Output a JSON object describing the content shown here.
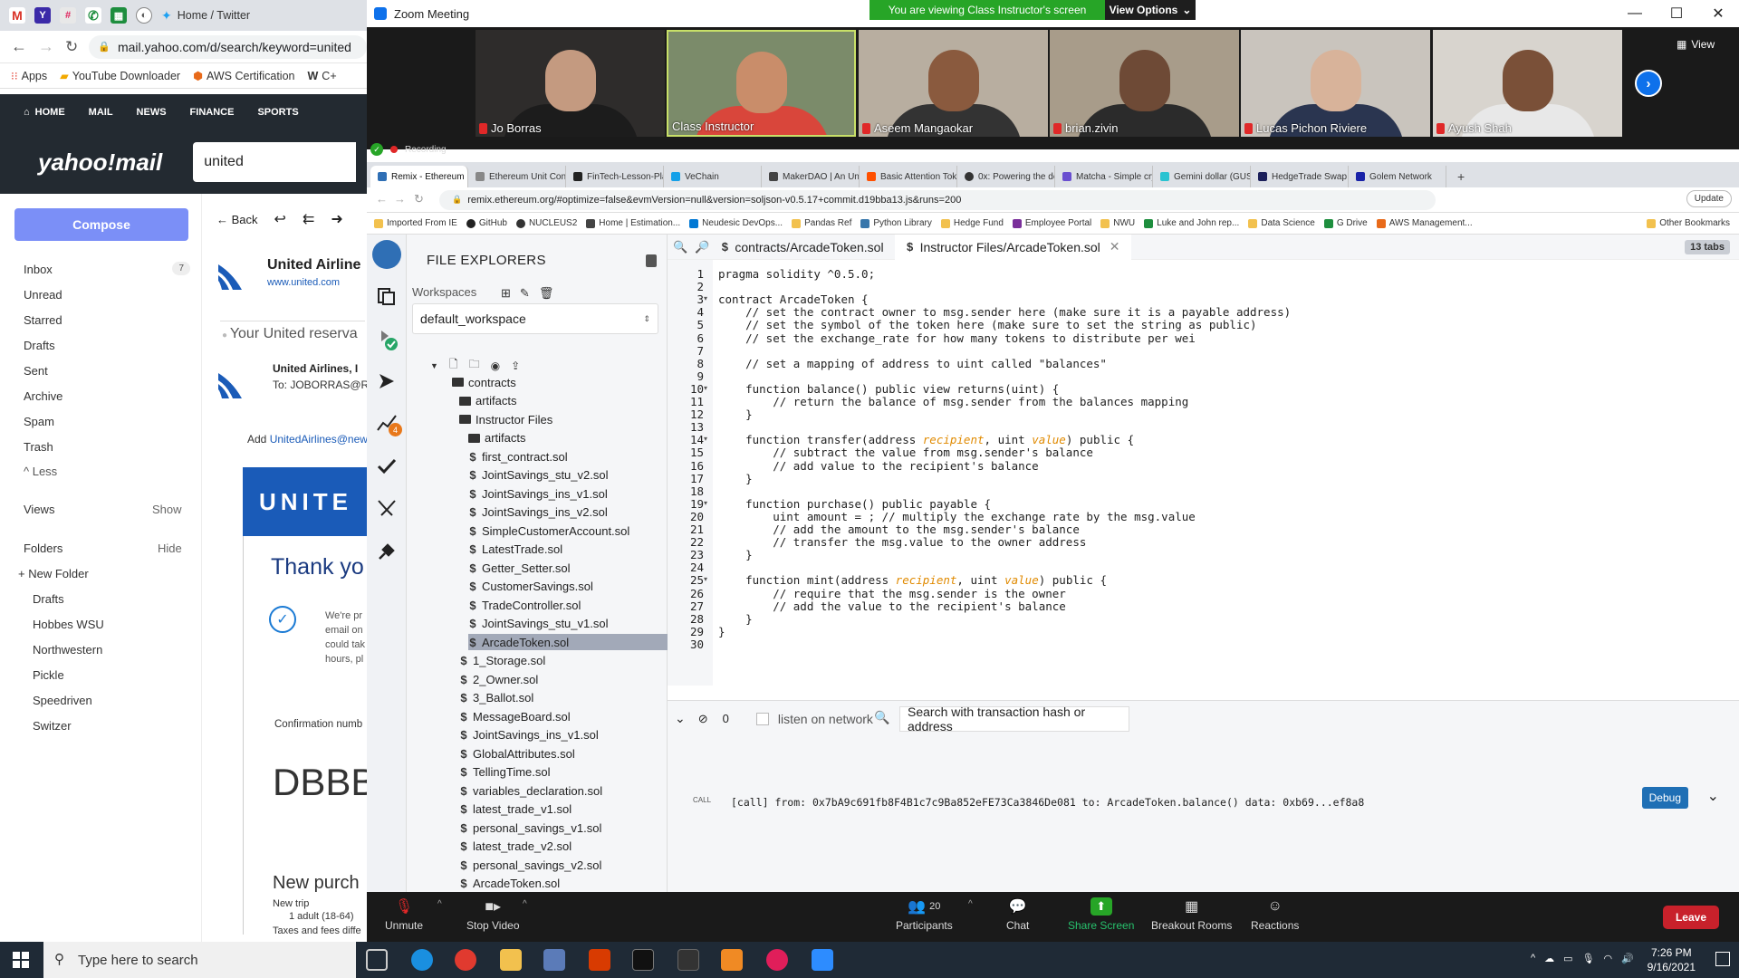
{
  "bg_browser": {
    "tab_title": "Home / Twitter",
    "url": "mail.yahoo.com/d/search/keyword=united",
    "bookmarks": [
      "Apps",
      "YouTube Downloader",
      "AWS Certification",
      "C+"
    ]
  },
  "yahoo": {
    "nav": [
      "HOME",
      "MAIL",
      "NEWS",
      "FINANCE",
      "SPORTS"
    ],
    "logo": "yahoo!mail",
    "search_value": "united",
    "compose": "Compose",
    "folders": [
      "Inbox",
      "Unread",
      "Starred",
      "Drafts",
      "Sent",
      "Archive",
      "Spam",
      "Trash"
    ],
    "inbox_count": "7",
    "less": "Less",
    "views": "Views",
    "show": "Show",
    "folders_label": "Folders",
    "hide": "Hide",
    "new_folder": "New Folder",
    "custom_folders": [
      "Drafts",
      "Hobbes WSU",
      "Northwestern",
      "Pickle",
      "Speedriven",
      "Switzer"
    ],
    "back": "Back",
    "sender_name": "United Airline",
    "sender_url": "www.united.com",
    "subject": "Your United reserva",
    "from": "United Airlines, I",
    "to": "To: JOBORRAS@R",
    "add_text": "Add ",
    "add_link": "UnitedAirlines@new",
    "banner": "UNITE",
    "thank": "Thank yo",
    "body_lines": [
      "We're pr",
      "email on",
      "could tak",
      "hours, pl"
    ],
    "confirmation": "Confirmation numb",
    "conf_code": "DBBB",
    "new_purchase": "New purch",
    "new_trip": "New trip",
    "adult": "1 adult (18-64)",
    "taxes": "Taxes and fees diffe"
  },
  "zoom": {
    "title": "Zoom Meeting",
    "viewing": "You are viewing Class Instructor's screen",
    "view_options": "View Options",
    "view": "View",
    "participants": [
      "Jo Borras",
      "Class Instructor",
      "Aseem Mangaokar",
      "brian.zivin",
      "Lucas Pichon Riviere",
      "Ayush Shah"
    ],
    "recording": "Recording",
    "toolbar": {
      "unmute": "Unmute",
      "stop_video": "Stop Video",
      "participants": "Participants",
      "participants_count": "20",
      "chat": "Chat",
      "share": "Share Screen",
      "breakout": "Breakout Rooms",
      "reactions": "Reactions",
      "leave": "Leave"
    }
  },
  "inner_browser": {
    "tabs": [
      "Remix - Ethereum",
      "Ethereum Unit Conver",
      "FinTech-Lesson-Plans",
      "VeChain",
      "MakerDAO | An Unbias",
      "Basic Attention Token",
      "0x: Powering the dece",
      "Matcha - Simple crypt",
      "Gemini dollar (GUSD)",
      "HedgeTrade Swap",
      "Golem Network"
    ],
    "url": "remix.ethereum.org/#optimize=false&evmVersion=null&version=soljson-v0.5.17+commit.d19bba13.js&runs=200",
    "update": "Update",
    "bookmarks": [
      "Imported From IE",
      "GitHub",
      "NUCLEUS2",
      "Home | Estimation...",
      "Neudesic DevOps...",
      "Pandas Ref",
      "Python Library",
      "Hedge Fund",
      "Employee Portal",
      "NWU",
      "Luke and John rep...",
      "Data Science",
      "G Drive",
      "AWS Management..."
    ],
    "other_bookmarks": "Other Bookmarks"
  },
  "remix": {
    "file_explorers": "FILE EXPLORERS",
    "workspaces": "Workspaces",
    "workspace": "default_workspace",
    "plugin_badge": "4",
    "tree": [
      {
        "name": "contracts",
        "type": "folder",
        "indent": 0
      },
      {
        "name": "artifacts",
        "type": "folder",
        "indent": 1
      },
      {
        "name": "Instructor Files",
        "type": "folder",
        "indent": 1
      },
      {
        "name": "artifacts",
        "type": "folder",
        "indent": 2
      },
      {
        "name": "first_contract.sol",
        "type": "file",
        "indent": 2
      },
      {
        "name": "JointSavings_stu_v2.sol",
        "type": "file",
        "indent": 2
      },
      {
        "name": "JointSavings_ins_v1.sol",
        "type": "file",
        "indent": 2
      },
      {
        "name": "JointSavings_ins_v2.sol",
        "type": "file",
        "indent": 2
      },
      {
        "name": "SimpleCustomerAccount.sol",
        "type": "file",
        "indent": 2
      },
      {
        "name": "LatestTrade.sol",
        "type": "file",
        "indent": 2
      },
      {
        "name": "Getter_Setter.sol",
        "type": "file",
        "indent": 2
      },
      {
        "name": "CustomerSavings.sol",
        "type": "file",
        "indent": 2
      },
      {
        "name": "TradeController.sol",
        "type": "file",
        "indent": 2
      },
      {
        "name": "JointSavings_stu_v1.sol",
        "type": "file",
        "indent": 2
      },
      {
        "name": "ArcadeToken.sol",
        "type": "file",
        "indent": 2,
        "selected": true
      },
      {
        "name": "1_Storage.sol",
        "type": "file",
        "indent": 1
      },
      {
        "name": "2_Owner.sol",
        "type": "file",
        "indent": 1
      },
      {
        "name": "3_Ballot.sol",
        "type": "file",
        "indent": 1
      },
      {
        "name": "MessageBoard.sol",
        "type": "file",
        "indent": 1
      },
      {
        "name": "JointSavings_ins_v1.sol",
        "type": "file",
        "indent": 1
      },
      {
        "name": "GlobalAttributes.sol",
        "type": "file",
        "indent": 1
      },
      {
        "name": "TellingTime.sol",
        "type": "file",
        "indent": 1
      },
      {
        "name": "variables_declaration.sol",
        "type": "file",
        "indent": 1
      },
      {
        "name": "latest_trade_v1.sol",
        "type": "file",
        "indent": 1
      },
      {
        "name": "personal_savings_v1.sol",
        "type": "file",
        "indent": 1
      },
      {
        "name": "latest_trade_v2.sol",
        "type": "file",
        "indent": 1
      },
      {
        "name": "personal_savings_v2.sol",
        "type": "file",
        "indent": 1
      },
      {
        "name": "ArcadeToken.sol",
        "type": "file",
        "indent": 1
      }
    ],
    "editor_tabs": [
      "contracts/ArcadeToken.sol",
      "Instructor Files/ArcadeToken.sol"
    ],
    "tabs_count": "13 tabs",
    "code_lines": [
      "pragma solidity ^0.5.0;",
      "",
      "contract ArcadeToken {",
      "    // set the contract owner to msg.sender here (make sure it is a payable address)",
      "    // set the symbol of the token here (make sure to set the string as public)",
      "    // set the exchange_rate for how many tokens to distribute per wei",
      "",
      "    // set a mapping of address to uint called \"balances\"",
      "",
      "    function balance() public view returns(uint) {",
      "        // return the balance of msg.sender from the balances mapping",
      "    }",
      "",
      "    function transfer(address recipient, uint value) public {",
      "        // subtract the value from msg.sender's balance",
      "        // add value to the recipient's balance",
      "    }",
      "",
      "    function purchase() public payable {",
      "        uint amount = ; // multiply the exchange rate by the msg.value",
      "        // add the amount to the msg.sender's balance",
      "        // transfer the msg.value to the owner address",
      "    }",
      "",
      "    function mint(address recipient, uint value) public {",
      "        // require that the msg.sender is the owner",
      "        // add the value to the recipient's balance",
      "    }",
      "}",
      ""
    ],
    "terminal": {
      "pending": "0",
      "listen": "listen on network",
      "search_placeholder": "Search with transaction hash or address",
      "log": "[call] from: 0x7bA9c691fb8F4B1c7c9Ba852eFE73Ca3846De081 to: ArcadeToken.balance() data: 0xb69...ef8a8",
      "debug": "Debug"
    }
  },
  "taskbar": {
    "search": "Type here to search",
    "time": "7:26 PM",
    "date": "9/16/2021"
  }
}
